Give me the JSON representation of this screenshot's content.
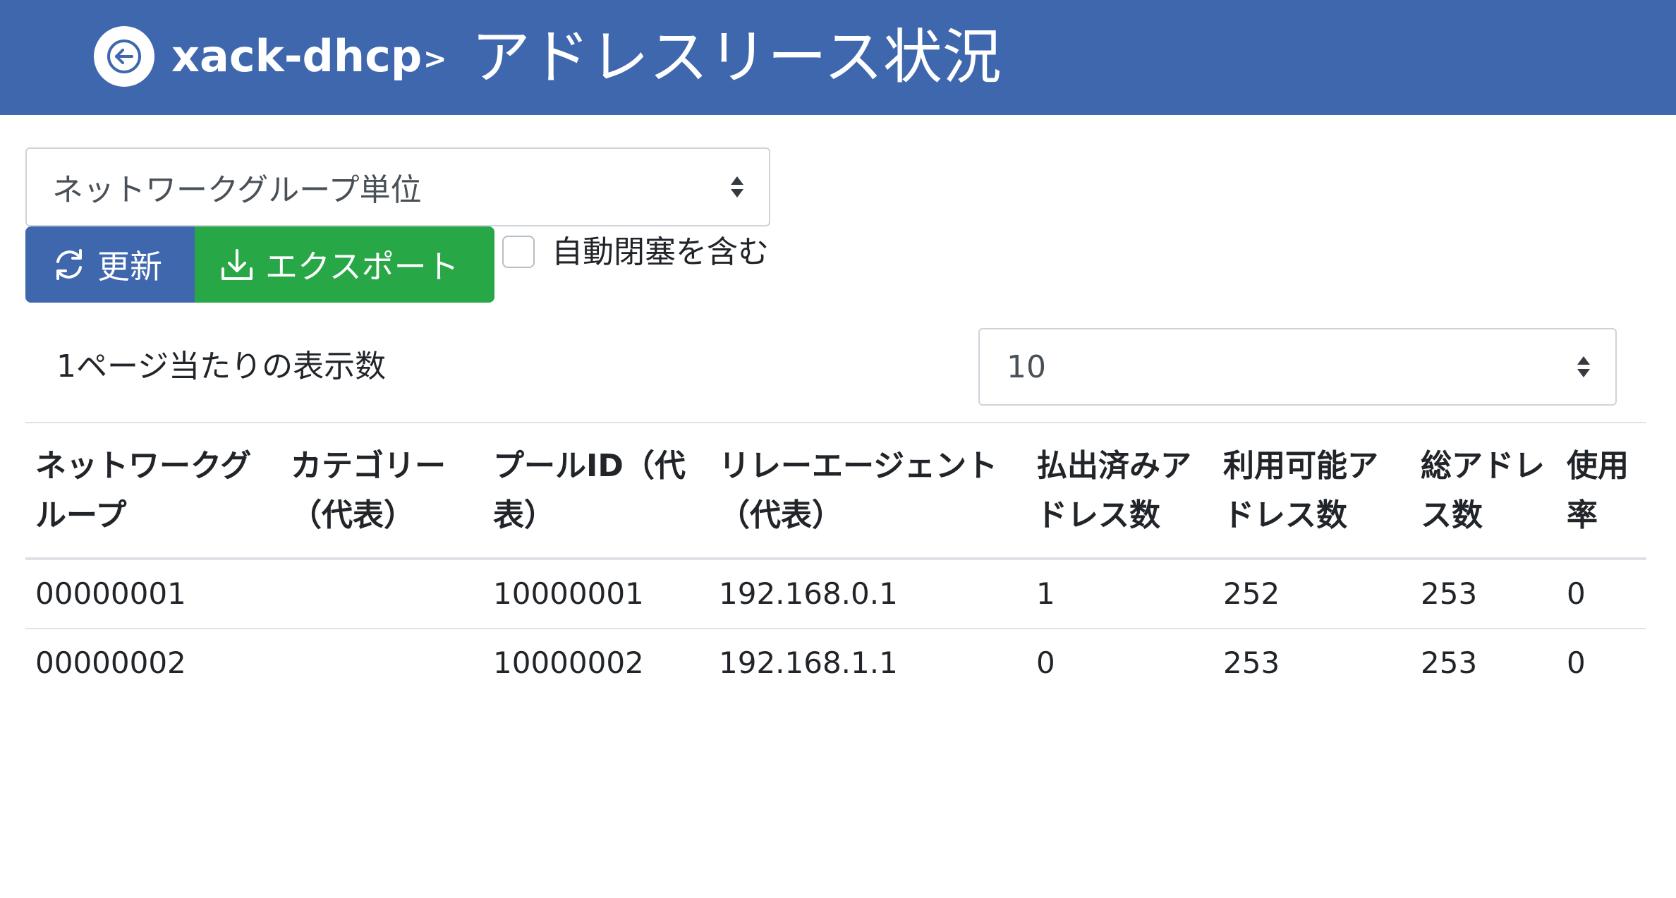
{
  "header": {
    "back_icon": "arrow-left-icon",
    "app_name": "xack-dhcp",
    "separator": ">",
    "title": "アドレスリース状況",
    "background": "#3f67ad"
  },
  "group_select": {
    "value": "ネットワークグループ単位"
  },
  "toolbar": {
    "refresh_label": "更新",
    "refresh_icon": "refresh-icon",
    "export_label": "エクスポート",
    "export_icon": "download-icon",
    "include_auto_closed_label": "自動閉塞を含む",
    "include_auto_closed_checked": false
  },
  "pagination": {
    "per_page_label": "1ページ当たりの表示数",
    "per_page_value": "10"
  },
  "table": {
    "columns": [
      "ネットワークグループ",
      "カテゴリー（代表）",
      "プールID（代表）",
      "リレーエージェント（代表）",
      "払出済みアドレス数",
      "利用可能アドレス数",
      "総アドレス数",
      "使用率"
    ],
    "rows": [
      [
        "00000001",
        "",
        "10000001",
        "192.168.0.1",
        "1",
        "252",
        "253",
        "0"
      ],
      [
        "00000002",
        "",
        "10000002",
        "192.168.1.1",
        "0",
        "253",
        "253",
        "0"
      ]
    ]
  },
  "colors": {
    "primary": "#3f67ad",
    "success": "#27a745",
    "border": "#dee2e6"
  }
}
